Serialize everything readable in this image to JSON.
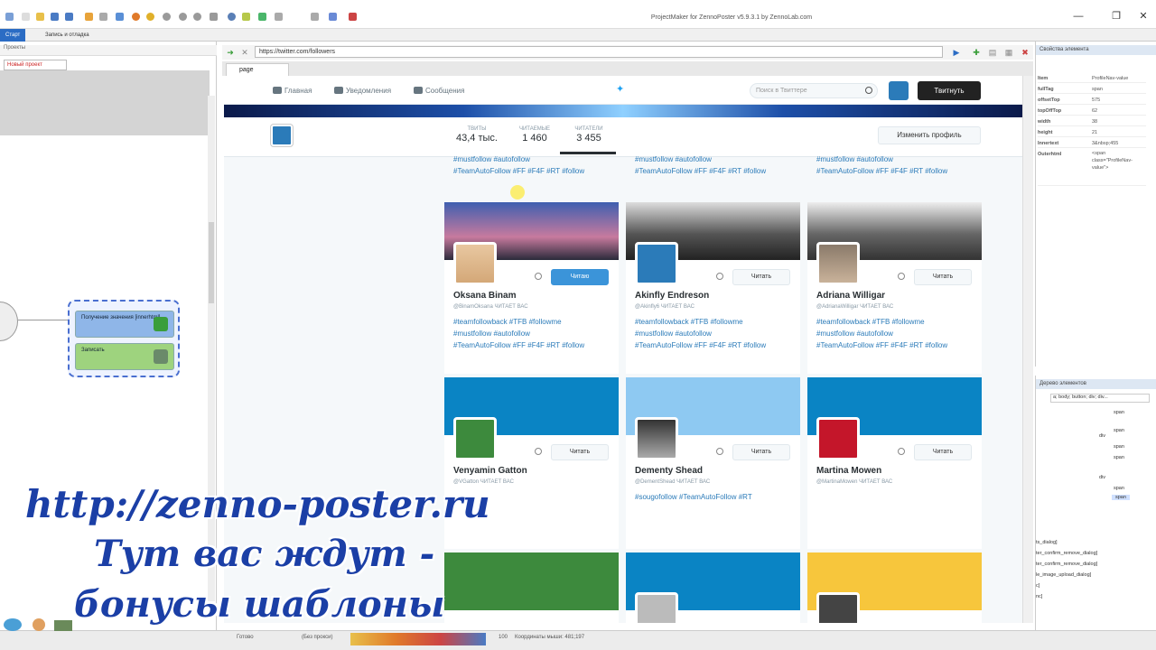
{
  "window": {
    "title": "ProjectMaker for ZennoPoster v5.9.3.1 by ZennoLab.com",
    "minimize": "—",
    "maximize": "❐",
    "close": "✕"
  },
  "tabs": [
    {
      "label": "Старт"
    },
    {
      "label": "Запись и отладка"
    }
  ],
  "left": {
    "pane_title": "Проекты",
    "project_tab": "Новый проект",
    "block1": "Получение значения [innerhtml]",
    "block2": "Записать"
  },
  "watermark": {
    "line1": "http://zenno-poster.ru",
    "line2": "Тут вас ждут -",
    "line3": "бонусы шаблоны"
  },
  "address": {
    "url": "https://twitter.com/followers"
  },
  "page_tab": "page",
  "twitter": {
    "nav": {
      "home": "Главная",
      "notifications": "Уведомления",
      "messages": "Сообщения",
      "search_placeholder": "Поиск в Твиттере",
      "tweet": "Твитнуть"
    },
    "stats": [
      {
        "label": "ТВИТЫ",
        "value": "43,4 тыс."
      },
      {
        "label": "ЧИТАЕМЫЕ",
        "value": "1 460"
      },
      {
        "label": "ЧИТАТЕЛИ",
        "value": "3 455"
      }
    ],
    "edit_profile": "Изменить профиль",
    "top_bio": [
      "#mustfollow #autofollow",
      "#TeamAutoFollow #FF #F4F #RT #follow"
    ],
    "follows_you": "ЧИТАЕТ ВАС",
    "cards": [
      {
        "name": "Oksana Binam",
        "handle": "@BinamOksana",
        "follow": "Читаю",
        "following": true,
        "bio": [
          "#teamfollowback #TFB #followme",
          "#mustfollow #autofollow",
          "#TeamAutoFollow #FF #F4F #RT #follow"
        ]
      },
      {
        "name": "Akinfly Endreson",
        "handle": "@Akinfly6",
        "follow": "Читать",
        "following": false,
        "bio": [
          "#teamfollowback #TFB #followme",
          "#mustfollow #autofollow",
          "#TeamAutoFollow #FF #F4F #RT #follow"
        ]
      },
      {
        "name": "Adriana Willigar",
        "handle": "@AdrianaWilligar",
        "follow": "Читать",
        "following": false,
        "bio": [
          "#teamfollowback #TFB #followme",
          "#mustfollow #autofollow",
          "#TeamAutoFollow #FF #F4F #RT #follow"
        ]
      },
      {
        "name": "Venyamin Gatton",
        "handle": "@VGatton",
        "follow": "Читать",
        "following": false,
        "bio": []
      },
      {
        "name": "Dementy Shead",
        "handle": "@DementShead",
        "follow": "Читать",
        "following": false,
        "bio": [
          "#sougofollow #TeamAutoFollow #RT"
        ]
      },
      {
        "name": "Martina Mowen",
        "handle": "@MartinaMowen",
        "follow": "Читать",
        "following": false,
        "bio": []
      }
    ]
  },
  "props": {
    "title": "Свойства элемента",
    "rows": [
      {
        "k": "Item",
        "v": "ProfileNav-value"
      },
      {
        "k": "fullTag",
        "v": "span"
      },
      {
        "k": "offsetTop",
        "v": "575"
      },
      {
        "k": "topOffTop",
        "v": "62"
      },
      {
        "k": "width",
        "v": "38"
      },
      {
        "k": "height",
        "v": "21"
      },
      {
        "k": "Innertext",
        "v": "3&nbsp;455"
      },
      {
        "k": "Outerhtml",
        "v": "<span class=\"ProfileNav-value\">"
      }
    ]
  },
  "tree": {
    "title": "Дерево элементов",
    "path": "a; body; button; div; div...",
    "nodes": [
      "span",
      "span",
      "div",
      "span",
      "span",
      "div",
      "span",
      "span"
    ]
  },
  "side_lines": [
    "ts_dialog]",
    "ter_confirm_remove_dialog]",
    "ter_confirm_remove_dialog]",
    "le_image_upload_dialog]",
    "c]",
    "nc]"
  ],
  "status": {
    "ready": "Готово",
    "proxy": "(Без прокси)",
    "zoom": "100",
    "coords": "Координаты мыши: 481;197"
  },
  "colors": {
    "accent": "#2b6cc4",
    "twitter_blue": "#1da1f2"
  }
}
